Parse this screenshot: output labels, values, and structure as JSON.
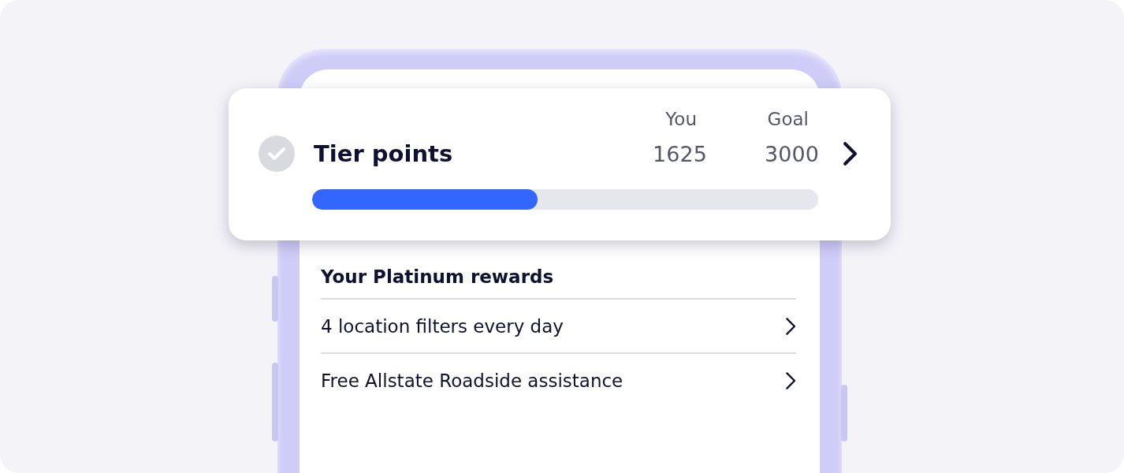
{
  "progress": {
    "title": "Tier points",
    "columns": [
      {
        "header": "You",
        "value": "1625"
      },
      {
        "header": "Goal",
        "value": "3000"
      }
    ],
    "level": 0.445
  },
  "rewards": {
    "title": "Your Platinum rewards",
    "items": [
      "4 location filters every day",
      "Free Allstate Roadside assistance"
    ]
  }
}
